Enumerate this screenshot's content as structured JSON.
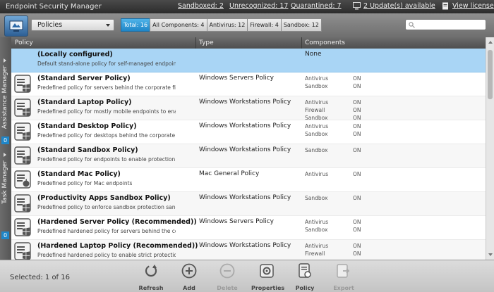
{
  "app": {
    "title": "Endpoint Security Manager",
    "stats": {
      "sandboxed": "Sandboxed: 2",
      "unrecognized": "Unrecognized: 17",
      "quarantined": "Quarantined: 7",
      "updates": "2 Update(s) available",
      "license": "View license"
    }
  },
  "toolbar": {
    "view_select": "Policies",
    "filters": [
      {
        "label": "Total: 16",
        "active": true
      },
      {
        "label": "All Components: 4",
        "active": false
      },
      {
        "label": "Antivirus: 12",
        "active": false
      },
      {
        "label": "Firewall: 4",
        "active": false
      },
      {
        "label": "Sandbox: 12",
        "active": false
      }
    ],
    "search_placeholder": ""
  },
  "side_panel": {
    "assistance_label": "Assistance Manager",
    "assistance_count": "0",
    "task_label": "Task Manager",
    "task_count": "0"
  },
  "table": {
    "columns": [
      "Policy",
      "Type",
      "Components"
    ],
    "rows": [
      {
        "name": "(Locally configured)",
        "desc": "Default stand-alone policy for self-managed endpoints",
        "type": "",
        "components": [],
        "none_label": "None",
        "selected": true,
        "icon": "local-config-icon"
      },
      {
        "name": "(Standard Server Policy)",
        "desc": "Predefined policy for servers behind the corporate firewa...",
        "type": "Windows Servers Policy",
        "components": [
          {
            "name": "Antivirus",
            "state": "ON"
          },
          {
            "name": "Sandbox",
            "state": "ON"
          }
        ],
        "icon": "windows-policy-icon"
      },
      {
        "name": "(Standard Laptop Policy)",
        "desc": "Predefined policy for mostly mobile endpoints to enable...",
        "type": "Windows Workstations Policy",
        "components": [
          {
            "name": "Antivirus",
            "state": "ON"
          },
          {
            "name": "Firewall",
            "state": "ON"
          },
          {
            "name": "Sandbox",
            "state": "ON"
          }
        ],
        "icon": "windows-policy-icon"
      },
      {
        "name": "(Standard Desktop Policy)",
        "desc": "Predefined policy for desktops behind the corporate fire...",
        "type": "Windows Workstations Policy",
        "components": [
          {
            "name": "Antivirus",
            "state": "ON"
          },
          {
            "name": "Sandbox",
            "state": "ON"
          }
        ],
        "icon": "windows-policy-icon"
      },
      {
        "name": "(Standard Sandbox Policy)",
        "desc": "Predefined policy for endpoints to enable protection with...",
        "type": "Windows Workstations Policy",
        "components": [
          {
            "name": "Sandbox",
            "state": "ON"
          }
        ],
        "icon": "windows-policy-icon"
      },
      {
        "name": "(Standard Mac Policy)",
        "desc": "Predefined policy for Mac endpoints",
        "type": "Mac General Policy",
        "components": [
          {
            "name": "Antivirus",
            "state": "ON"
          }
        ],
        "icon": "mac-policy-icon"
      },
      {
        "name": "(Productivity Apps Sandbox Policy)",
        "desc": "Predefined policy to enforce sandbox protection sandbox...",
        "type": "Windows Workstations Policy",
        "components": [
          {
            "name": "Sandbox",
            "state": "ON"
          }
        ],
        "icon": "windows-policy-icon"
      },
      {
        "name": "(Hardened Server Policy (Recommended))",
        "desc": "Predefined hardened policy for servers behind the corpor...",
        "type": "Windows Servers Policy",
        "components": [
          {
            "name": "Antivirus",
            "state": "ON"
          },
          {
            "name": "Sandbox",
            "state": "ON"
          }
        ],
        "icon": "windows-policy-icon"
      },
      {
        "name": "(Hardened Laptop Policy (Recommended))",
        "desc": "Predefined hardened policy to enable strict protection w...",
        "type": "Windows Workstations Policy",
        "components": [
          {
            "name": "Antivirus",
            "state": "ON"
          },
          {
            "name": "Firewall",
            "state": "ON"
          }
        ],
        "icon": "windows-policy-icon"
      }
    ]
  },
  "footer": {
    "selected": "Selected: 1 of 16",
    "actions": [
      {
        "label": "Refresh",
        "icon": "refresh-icon",
        "enabled": true
      },
      {
        "label": "Add",
        "icon": "add-icon",
        "enabled": true
      },
      {
        "label": "Delete",
        "icon": "delete-icon",
        "enabled": false
      },
      {
        "label": "Properties",
        "icon": "properties-icon",
        "enabled": true
      },
      {
        "label": "Policy",
        "icon": "policy-icon",
        "enabled": true
      },
      {
        "label": "Export",
        "icon": "export-icon",
        "enabled": false
      }
    ]
  },
  "colors": {
    "accent": "#1f86c8",
    "selected_row": "#a9d5f5"
  }
}
